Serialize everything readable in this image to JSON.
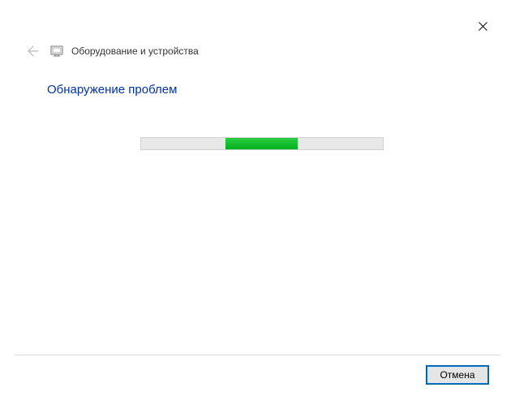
{
  "header": {
    "title": "Оборудование и устройства"
  },
  "content": {
    "heading": "Обнаружение проблем"
  },
  "footer": {
    "cancel_label": "Отмена"
  },
  "progress": {
    "position_percent": 35,
    "width_percent": 30
  }
}
